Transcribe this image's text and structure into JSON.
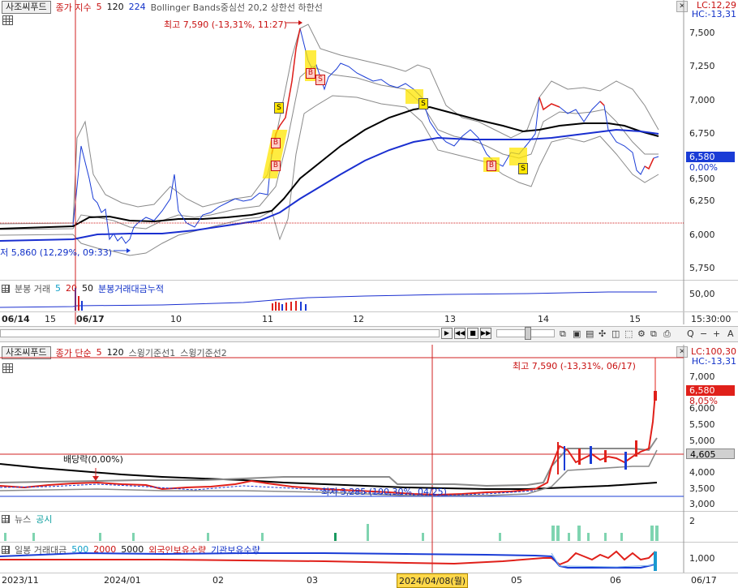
{
  "top_chart": {
    "stock_tab": "사조씨푸드",
    "legend": {
      "ma_prefix": "종가 지수",
      "ma_values": [
        "5",
        "120",
        "224"
      ],
      "indicators": "Bollinger Bands중심선 20,2  상한선  하한선"
    },
    "lc": "LC:12,29",
    "hc": "HC:-13,31",
    "high_label": "최고 7,590 (-13,31%, 11:27)",
    "low_label": "최저 5,860 (12,29%, 09:33)",
    "current_price": "6,580",
    "current_pct": "0,00%",
    "y_ticks": [
      "7,500",
      "7,250",
      "7,000",
      "6,750",
      "6,500",
      "6,250",
      "6,000",
      "5,750"
    ],
    "signals": [
      "S",
      "B",
      "B",
      "B",
      "S",
      "B",
      "B",
      "S",
      "B",
      "S"
    ],
    "volume_legend": {
      "prefix": "분봉 거래",
      "v1": "5",
      "v2": "20",
      "v3": "50",
      "cumulative": "분봉거래대금누적"
    },
    "volume_tick": "50,00",
    "x_labels": [
      "06/14",
      "15",
      "06/17",
      "10",
      "11",
      "12",
      "13",
      "14",
      "15"
    ],
    "time_label": "15:30:00"
  },
  "toolbar": {
    "zoom_minus": "−",
    "zoom_plus": "+",
    "search": "Q",
    "font": "A"
  },
  "bottom_chart": {
    "stock_tab": "사조씨푸드",
    "legend": {
      "ma_prefix": "종가 단순",
      "ma_values": [
        "5",
        "120"
      ],
      "swing1": "스윙기준선1",
      "swing2": "스윙기준선2"
    },
    "lc": "LC:100,30",
    "hc": "HC:-13,31",
    "high_label": "최고 7,590 (-13,31%, 06/17)",
    "low_label": "최저 3,285 (100,30%, 04/25)",
    "dividend_label": "배당락(0,00%)",
    "current_price": "6,580",
    "current_pct": "8,05%",
    "hover_price": "4,605",
    "y_ticks": [
      "7,000",
      "6,500",
      "6,000",
      "5,500",
      "5,000",
      "4,500",
      "4,000",
      "3,500",
      "3,000"
    ],
    "news_legend": {
      "news": "뉴스",
      "disclosure": "공시"
    },
    "news_tick": "2",
    "volume_legend": {
      "prefix": "일봉 거래대금",
      "v1": "500",
      "v2": "2000",
      "v3": "5000",
      "foreign": "외국인보유수량",
      "institution": "기관보유수량"
    },
    "volume_tick": "1,000",
    "x_labels": [
      "2023/11",
      "2024/01",
      "02",
      "03",
      "2024/04/08(월)",
      "05",
      "06",
      "06/17"
    ]
  },
  "colors": {
    "up": "#e0201a",
    "down": "#1a3cd6",
    "bb": "#8a8a8a",
    "ma120": "#000000",
    "ma224": "#1a2fd0",
    "signal": "#ffe600",
    "news": "#7fd4b0",
    "price_tag": "#e0201a",
    "hover_tag": "#d0d0d0"
  }
}
